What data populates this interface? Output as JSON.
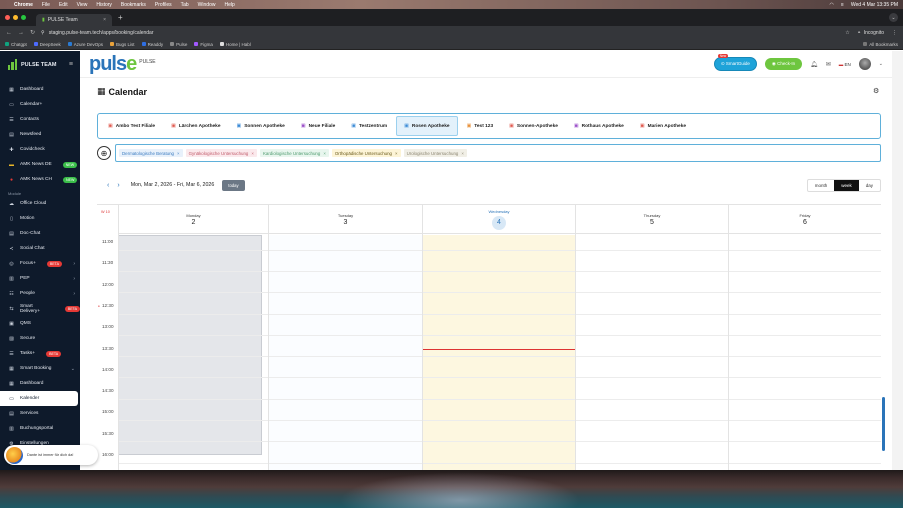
{
  "menubar": {
    "app": "Chrome",
    "items": [
      "File",
      "Edit",
      "View",
      "History",
      "Bookmarks",
      "Profiles",
      "Tab",
      "Window",
      "Help"
    ],
    "clock": "Wed 4 Mar 13:35 PM"
  },
  "browser": {
    "tab_title": "PULSE Team",
    "url": "staging.pulse-team.tech/apps/booking/calendar",
    "incognito_label": "Incognito",
    "bookmarks": [
      "Chatgpt",
      "DeepSeek",
      "Azure DevOps",
      "Bugs List",
      "Readdy",
      "Pulse",
      "Figma",
      "Home | Habl"
    ],
    "all_bookmarks": "All Bookmarks"
  },
  "sidebar": {
    "brand": "PULSE TEAM",
    "items_top": [
      {
        "label": "Dashboard",
        "icon": "dashboard-icon"
      },
      {
        "label": "Calendar+",
        "icon": "calendar-icon"
      },
      {
        "label": "Contacts",
        "icon": "contacts-icon"
      },
      {
        "label": "Newsfeed",
        "icon": "newsfeed-icon"
      },
      {
        "label": "Covidcheck",
        "icon": "covid-icon"
      },
      {
        "label": "AMK News DE",
        "icon": "flag-de-icon",
        "badge": "NEW"
      },
      {
        "label": "AMK News CH",
        "icon": "flag-ch-icon",
        "badge": "NEW"
      }
    ],
    "module_label": "Module",
    "items_module": [
      {
        "label": "Office Cloud",
        "icon": "cloud-icon"
      },
      {
        "label": "Motion",
        "icon": "motion-icon"
      },
      {
        "label": "Doc-Chat",
        "icon": "chat-icon"
      },
      {
        "label": "Social Chat",
        "icon": "social-icon"
      },
      {
        "label": "Focus+",
        "icon": "focus-icon",
        "badge": "BETA"
      },
      {
        "label": "PEP",
        "icon": "pep-icon"
      },
      {
        "label": "People",
        "icon": "people-icon"
      },
      {
        "label": "Smart Delivery+",
        "icon": "delivery-icon",
        "badge": "BETA"
      },
      {
        "label": "QMS",
        "icon": "qms-icon"
      },
      {
        "label": "Secure",
        "icon": "secure-icon"
      },
      {
        "label": "Tasks+",
        "icon": "tasks-icon",
        "badge": "BETA"
      },
      {
        "label": "Smart Booking",
        "icon": "booking-icon"
      },
      {
        "label": "Dashboard",
        "icon": "dashboard-icon"
      },
      {
        "label": "Kalender",
        "icon": "calendar-icon",
        "active": true
      },
      {
        "label": "Services",
        "icon": "services-icon"
      },
      {
        "label": "Buchungsportal",
        "icon": "portal-icon"
      },
      {
        "label": "Einstellungen",
        "icon": "settings-icon"
      }
    ],
    "toast_text": "Dante ist immer für dich da!"
  },
  "header": {
    "logo": "pulse",
    "logo_sub": "PULSE",
    "guide_label": "SmartGuide",
    "guide_new": "New",
    "checkin_label": "Check-In",
    "lang": "EN"
  },
  "page": {
    "title": "Calendar",
    "locations": [
      {
        "label": "Ambo Test Filiale",
        "color": "#e0584d"
      },
      {
        "label": "Lärchen Apotheke",
        "color": "#e0584d"
      },
      {
        "label": "Sonnen Apotheke",
        "color": "#3a8ad6"
      },
      {
        "label": "Neue Filiale",
        "color": "#9b4fc9"
      },
      {
        "label": "Testzentrum",
        "color": "#3a8ad6"
      },
      {
        "label": "Rosen Apotheke",
        "color": "#3a8ad6",
        "selected": true
      },
      {
        "label": "Test 123",
        "color": "#e8913b"
      },
      {
        "label": "Sonnen-Apotheke",
        "color": "#e0584d"
      },
      {
        "label": "Rothaus Apotheke",
        "color": "#9b4fc9"
      },
      {
        "label": "Marien Apotheke",
        "color": "#e0584d"
      }
    ],
    "filters": [
      {
        "label": "Dermatologische Beratung",
        "bg": "#e8f1fb",
        "fg": "#3a7bc0"
      },
      {
        "label": "Gynäkologische Untersuchung",
        "bg": "#fbe9ec",
        "fg": "#c05a6a"
      },
      {
        "label": "Kardiologische Untersuchung",
        "bg": "#e8f6ee",
        "fg": "#4e9a6e"
      },
      {
        "label": "Orthopädische Untersuchung",
        "bg": "#fdf4d6",
        "fg": "#6a5a1c"
      },
      {
        "label": "Urologische Untersuchung",
        "bg": "#f1efe6",
        "fg": "#8a8470"
      }
    ]
  },
  "calendar": {
    "range": "Mon, Mar 2, 2026 - Fri, Mar 6, 2026",
    "today_label": "today",
    "views": [
      "month",
      "week",
      "day"
    ],
    "active_view": "week",
    "week_no": "W 10",
    "days": [
      {
        "name": "Monday",
        "num": "2"
      },
      {
        "name": "Tuesday",
        "num": "3"
      },
      {
        "name": "Wednesday",
        "num": "4",
        "current": true
      },
      {
        "name": "Thursday",
        "num": "5"
      },
      {
        "name": "Friday",
        "num": "6"
      }
    ],
    "times": [
      "11:00",
      "11:30",
      "12:00",
      "12:30",
      "13:00",
      "13:30",
      "14:00",
      "14:30",
      "15:00",
      "15:30",
      "16:00",
      "16:30"
    ],
    "now_time": "12:30"
  }
}
